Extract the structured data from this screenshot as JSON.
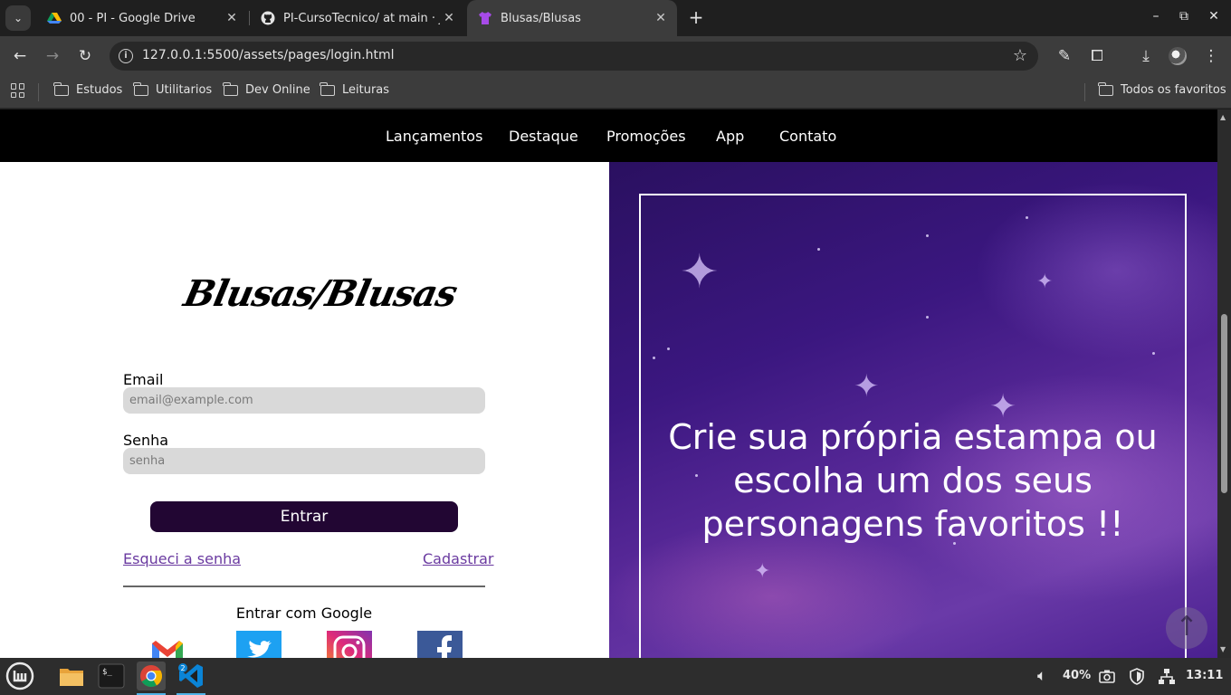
{
  "browser": {
    "tabs": [
      {
        "title": "00 - PI - Google Drive",
        "active": false
      },
      {
        "title": "PI-CursoTecnico/ at main · Jo",
        "active": false
      },
      {
        "title": "Blusas/Blusas",
        "active": true
      }
    ],
    "url": "127.0.0.1:5500/assets/pages/login.html",
    "bookmarks": [
      "Estudos",
      "Utilitarios",
      "Dev Online",
      "Leituras"
    ],
    "all_bookmarks": "Todos os favoritos"
  },
  "site": {
    "nav": [
      "Lançamentos",
      "Destaque",
      "Promoções",
      "App",
      "Contato"
    ],
    "logo": "Blusas/Blusas",
    "email_label": "Email",
    "email_placeholder": "email@example.com",
    "password_label": "Senha",
    "password_placeholder": "senha",
    "login_button": "Entrar",
    "forgot_link": "Esqueci a senha",
    "signup_link": "Cadastrar",
    "google_text": "Entrar com Google",
    "social_icons": [
      "gmail-icon",
      "twitter-icon",
      "instagram-icon",
      "facebook-icon"
    ],
    "hero_text": "Crie sua própria estampa ou escolha um dos seus personagens favoritos !!"
  },
  "taskbar": {
    "volume": "40%",
    "time": "13:11",
    "vscode_badge": "2"
  },
  "colors": {
    "login_button": "#220633",
    "link": "#6a3aa0",
    "nav_bg": "#000000"
  }
}
